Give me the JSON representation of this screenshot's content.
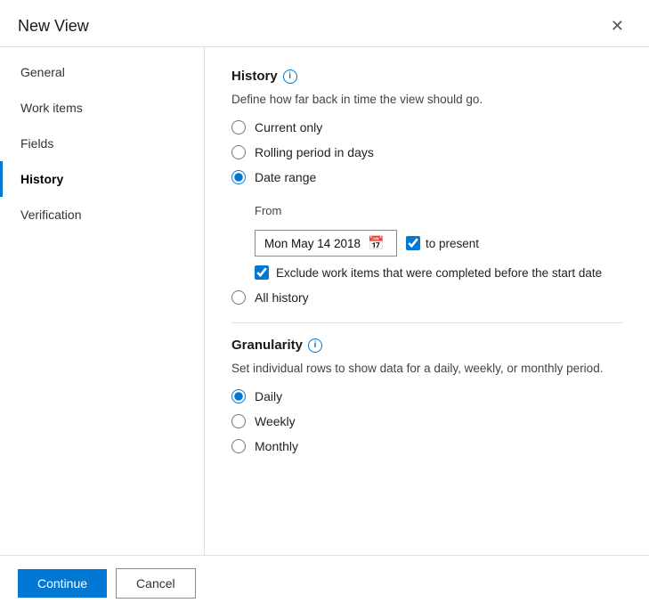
{
  "dialog": {
    "title": "New View",
    "close_label": "✕"
  },
  "sidebar": {
    "items": [
      {
        "id": "general",
        "label": "General",
        "active": false
      },
      {
        "id": "work-items",
        "label": "Work items",
        "active": false
      },
      {
        "id": "fields",
        "label": "Fields",
        "active": false
      },
      {
        "id": "history",
        "label": "History",
        "active": true
      },
      {
        "id": "verification",
        "label": "Verification",
        "active": false
      }
    ]
  },
  "history": {
    "title": "History",
    "description": "Define how far back in time the view should go.",
    "options": [
      {
        "id": "current-only",
        "label": "Current only",
        "checked": false
      },
      {
        "id": "rolling-period",
        "label": "Rolling period in days",
        "checked": false
      },
      {
        "id": "date-range",
        "label": "Date range",
        "checked": true
      },
      {
        "id": "all-history",
        "label": "All history",
        "checked": false
      }
    ],
    "from_label": "From",
    "date_value": "Mon May 14 2018",
    "to_present_label": "to present",
    "to_present_checked": true,
    "exclude_label": "Exclude work items that were completed before the start date",
    "exclude_checked": true
  },
  "granularity": {
    "title": "Granularity",
    "description": "Set individual rows to show data for a daily, weekly, or monthly period.",
    "options": [
      {
        "id": "daily",
        "label": "Daily",
        "checked": true
      },
      {
        "id": "weekly",
        "label": "Weekly",
        "checked": false
      },
      {
        "id": "monthly",
        "label": "Monthly",
        "checked": false
      }
    ]
  },
  "footer": {
    "continue_label": "Continue",
    "cancel_label": "Cancel"
  }
}
